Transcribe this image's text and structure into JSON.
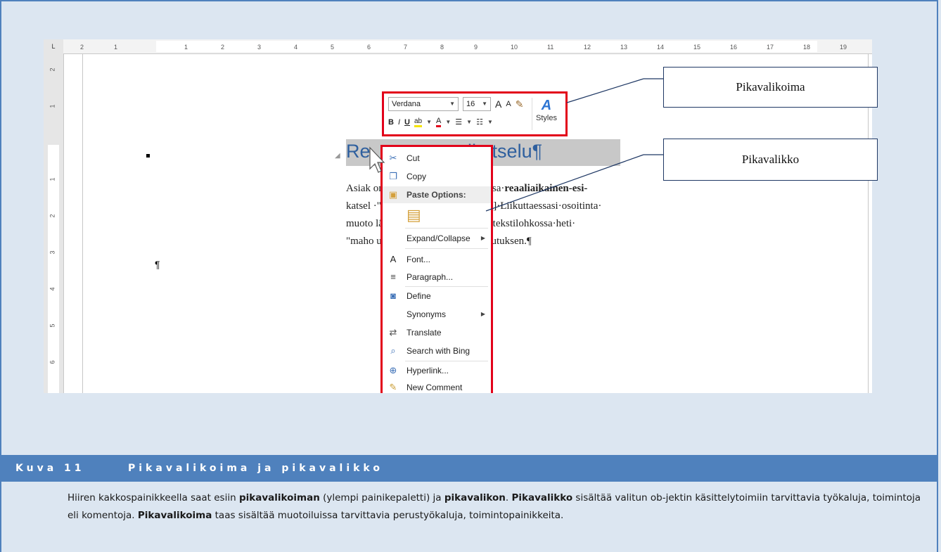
{
  "ruler": {
    "corner": "L",
    "h_ticks": [
      "2",
      "1",
      "1",
      "2",
      "3",
      "4",
      "5",
      "6",
      "7",
      "8",
      "9",
      "10",
      "11",
      "12",
      "13",
      "14",
      "15",
      "16",
      "17",
      "18",
      "19"
    ],
    "v_ticks": [
      "2",
      "1",
      "1",
      "2",
      "3",
      "4",
      "5",
      "6"
    ]
  },
  "document": {
    "heading_start": "Re",
    "heading_end": "n·esikatselu¶",
    "body_lines": [
      "Asiak                          on·oletusasetuksena·voimassa·",
      "katsel                     ·\"Reaaliaikainen·esikatselu\"]·Liikuttaessasi·osoitinta·",
      "muoto                     lä·näet·asiakirjan·valitussa·tekstilohkossa·heti·",
      "\"maho                     uutoksen·aiheuttaman·vaikutuksen.¶"
    ],
    "body_bold": "reaaliaikainen-esi-",
    "pilcrow": "¶"
  },
  "mini_toolbar": {
    "font_name": "Verdana",
    "font_size": "16",
    "grow": "A",
    "shrink": "A",
    "bold": "B",
    "italic": "I",
    "underline": "U",
    "highlight": "ab",
    "font_color": "A",
    "styles_label": "Styles"
  },
  "context_menu": {
    "items": [
      {
        "label": "Cut",
        "icon": "scissors-icon"
      },
      {
        "label": "Copy",
        "icon": "copy-icon"
      },
      {
        "label": "Paste Options:",
        "icon": "paste-icon"
      },
      {
        "label": "Expand/Collapse",
        "icon": ""
      },
      {
        "label": "Font...",
        "icon": "font-icon"
      },
      {
        "label": "Paragraph...",
        "icon": "paragraph-icon"
      },
      {
        "label": "Define",
        "icon": "define-icon"
      },
      {
        "label": "Synonyms",
        "icon": ""
      },
      {
        "label": "Translate",
        "icon": "translate-icon"
      },
      {
        "label": "Search with Bing",
        "icon": "search-icon"
      },
      {
        "label": "Hyperlink...",
        "icon": "hyperlink-icon"
      },
      {
        "label": "New Comment",
        "icon": "comment-icon"
      }
    ]
  },
  "callouts": {
    "toolbar": "Pikavalikoima",
    "menu": "Pikavalikko"
  },
  "caption": {
    "number": "Kuva 11",
    "title": "Pikavalikoima ja pikavalikko"
  },
  "description": {
    "t1": "Hiiren kakkospainikkeella saat esiin ",
    "b1": "pikavalikoiman",
    "t2": " (ylempi painikepaletti) ja ",
    "b2": "pikavalikon",
    "t3": ". ",
    "b3": "Pikavalikko",
    "t4": " sisältää valitun ob-jektin käsittelytoimiin tarvittavia työkaluja, toimintoja eli komentoja. ",
    "b4": "Pikavalikoima",
    "t5": " taas sisältää muotoiluissa tarvittavia perustyökaluja, toimintopainikkeita."
  },
  "colors": {
    "frame": "#4f81bd",
    "background": "#dce6f1",
    "highlight_red": "#e2001a",
    "heading_blue": "#2e5f9e"
  }
}
